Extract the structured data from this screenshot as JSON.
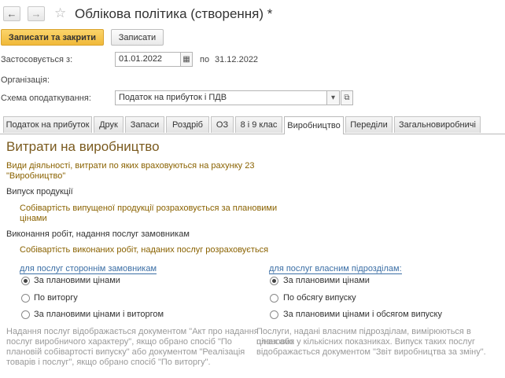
{
  "header": {
    "back_glyph": "←",
    "forward_glyph": "→",
    "star_glyph": "☆",
    "title": "Облікова політика (створення) *"
  },
  "toolbar": {
    "save_close_label": "Записати та закрити",
    "save_label": "Записати"
  },
  "form": {
    "applies_label": "Застосовується з:",
    "date_from": "01.01.2022",
    "to_label": "по",
    "date_to": "31.12.2022",
    "org_label": "Організація:",
    "tax_label": "Схема оподаткування:",
    "tax_value": "Податок на прибуток і ПДВ",
    "calendar_glyph": "▦",
    "dropdown_glyph": "▾",
    "open_glyph": "⧉"
  },
  "tabs": [
    {
      "label": "Податок на прибуток",
      "active": false
    },
    {
      "label": "Друк",
      "active": false
    },
    {
      "label": "Запаси",
      "active": false
    },
    {
      "label": "Роздріб",
      "active": false
    },
    {
      "label": "ОЗ",
      "active": false
    },
    {
      "label": "8 і 9 клас",
      "active": false
    },
    {
      "label": "Виробництво",
      "active": true
    },
    {
      "label": "Переділи",
      "active": false
    },
    {
      "label": "Загальновиробничі",
      "active": false
    }
  ],
  "production": {
    "title": "Витрати на виробництво",
    "activities_line1": "Види діяльності, витрати по яких враховуються на рахунку 23",
    "activities_line2": "\"Виробництво\"",
    "output_label": "Випуск продукції",
    "output_note_line1": "Собівартість випущеної продукції розраховується за плановими",
    "output_note_line2": "цінами",
    "works_label": "Виконання робіт, надання послуг замовникам",
    "works_note": "Собівартість виконаних робіт, наданих послуг розраховується",
    "external": {
      "heading": "для послуг стороннім замовникам",
      "options": [
        "За плановими цінами",
        "По виторгу",
        "За плановими цінами і виторгом"
      ],
      "selected": 0,
      "note_lines": [
        "Надання послуг відображається документом \"Акт про надання",
        "послуг виробничого характеру\", якщо обрано спосіб \"По",
        "плановій собівартості випуску\" або документом \"Реалізація",
        "товарів і послуг\", якщо обрано спосіб \"По виторгу\"."
      ]
    },
    "internal": {
      "heading": "для послуг власним підрозділам:",
      "options": [
        "За плановими цінами",
        "По обсягу випуску",
        "За плановими цінами і обсягом випуску"
      ],
      "selected": 0,
      "note_lines": [
        "Послуги, надані власним підрозділам, вимірюються в планових",
        "цінах або у кількісних показниках. Випуск таких послуг",
        "відображається документом \"Звіт виробництва за зміну\"."
      ]
    }
  }
}
